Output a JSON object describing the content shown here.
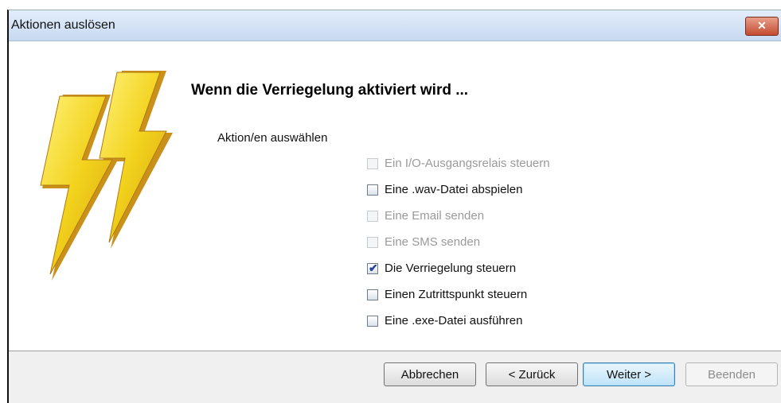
{
  "window": {
    "title": "Aktionen auslösen",
    "close_symbol": "✕"
  },
  "heading": "Wenn die Verriegelung aktiviert wird ...",
  "section_label": "Aktion/en auswählen",
  "icon": "lightning-bolts-icon",
  "options": [
    {
      "label": "Ein I/O-Ausgangsrelais steuern",
      "checked": false,
      "enabled": false
    },
    {
      "label": "Eine .wav-Datei abspielen",
      "checked": false,
      "enabled": true
    },
    {
      "label": "Eine Email senden",
      "checked": false,
      "enabled": false
    },
    {
      "label": "Eine SMS senden",
      "checked": false,
      "enabled": false
    },
    {
      "label": "Die Verriegelung steuern",
      "checked": true,
      "enabled": true
    },
    {
      "label": "Einen Zutrittspunkt steuern",
      "checked": false,
      "enabled": true
    },
    {
      "label": "Eine .exe-Datei ausführen",
      "checked": false,
      "enabled": true
    }
  ],
  "buttons": {
    "cancel": "Abbrechen",
    "back": "< Zurück",
    "next": "Weiter >",
    "finish": "Beenden"
  },
  "colors": {
    "bolt_fill": "#f2d21c",
    "bolt_shade": "#c9901a",
    "title_bar": "#c7d9f1",
    "close_button": "#c54a2f"
  }
}
